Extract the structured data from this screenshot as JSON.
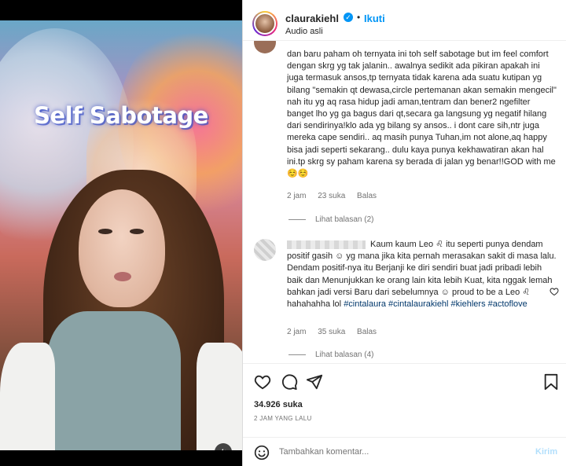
{
  "post": {
    "username": "claurakiehl",
    "follow_label": "Ikuti",
    "separator": "•",
    "audio": "Audio asli",
    "overlay_text": "Self Sabotage"
  },
  "comments": [
    {
      "text": "dan baru paham oh ternyata ini toh self sabotage but im feel comfort dengan skrg yg tak jalanin.. awalnya sedikit ada pikiran apakah ini juga termasuk ansos,tp ternyata tidak karena ada suatu kutipan yg bilang \"semakin qt dewasa,circle pertemanan akan semakin mengecil\"",
      "text2": "nah itu yg aq rasa hidup jadi aman,tentram dan bener2 ngefilter banget lho yg ga bagus dari qt,secara ga langsung yg negatif hilang dari sendirinya!klo ada yg bilang sy ansos.. i dont care sih,ntr juga mereka cape sendiri.. aq masih punya Tuhan,im not alone,aq happy bisa jadi seperti sekarang.. dulu kaya punya kekhawatiran akan hal ini.tp skrg sy paham karena sy berada di jalan yg benar!!GOD with me ☺️☺️",
      "time": "2 jam",
      "likes": "23 suka",
      "reply": "Balas",
      "view_replies": "Lihat balasan (2)"
    },
    {
      "text": "Kaum kaum Leo ♌ itu seperti punya dendam positif gasih ☺ yg mana jika kita pernah merasakan sakit di masa lalu. Dendam positif-nya itu Berjanji ke diri sendiri buat jadi pribadi lebih baik dan Menunjukkan ke orang lain kita lebih Kuat, kita nggak lemah bahkan jadi versi Baru dari sebelumnya ☺ proud to be a Leo ♌ hahahahha lol",
      "tags": "#cintalaura #cintalaurakiehl #kiehlers #actoflove",
      "time": "2 jam",
      "likes": "35 suka",
      "reply": "Balas",
      "view_replies": "Lihat balasan (4)"
    }
  ],
  "footer": {
    "likes": "34.926 suka",
    "time": "2 JAM YANG LALU",
    "add_comment_placeholder": "Tambahkan komentar...",
    "send_label": "Kirim"
  }
}
